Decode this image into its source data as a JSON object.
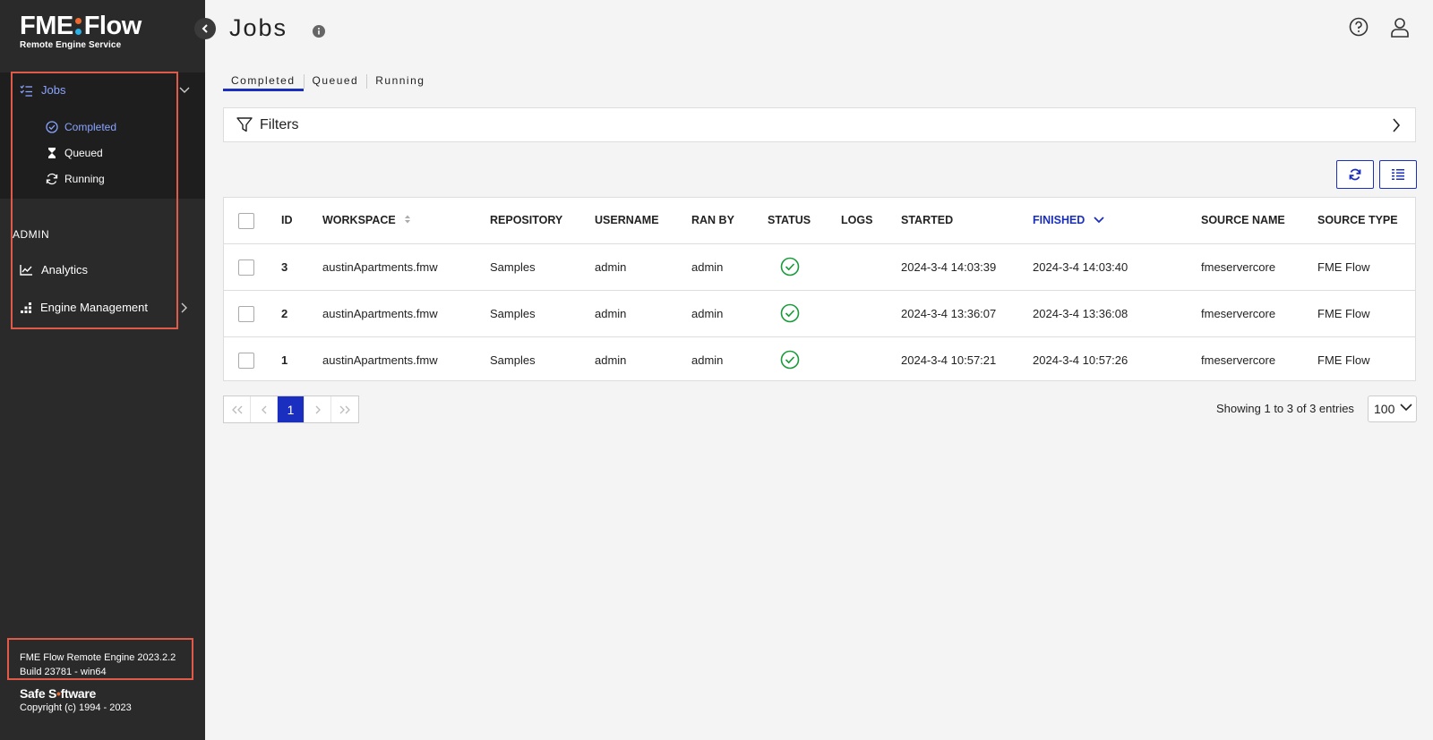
{
  "app": {
    "logo_main_left": "FME",
    "logo_main_right": "Flow",
    "logo_sub": "Remote Engine Service",
    "accent": "#1a2fbf",
    "sidebar_bg": "#2a2a2a",
    "highlight": "#e05a4a"
  },
  "sidebar": {
    "jobs_label": "Jobs",
    "sub_items": [
      {
        "label": "Completed",
        "icon": "check-circle-icon",
        "active": true
      },
      {
        "label": "Queued",
        "icon": "hourglass-icon"
      },
      {
        "label": "Running",
        "icon": "sync-icon"
      }
    ],
    "admin_label": "ADMIN",
    "analytics_label": "Analytics",
    "engine_label": "Engine Management",
    "version_line1": "FME Flow Remote Engine 2023.2.2",
    "version_line2": "Build 23781 - win64",
    "safe_logo_left": "Safe S",
    "safe_logo_right": "ftware",
    "copyright": "Copyright (c) 1994 - 2023"
  },
  "header": {
    "title": "Jobs",
    "help_icon": "help-icon",
    "user_icon": "user-icon"
  },
  "tabs": [
    {
      "label": "Completed",
      "active": true
    },
    {
      "label": "Queued"
    },
    {
      "label": "Running"
    }
  ],
  "filters": {
    "label": "Filters"
  },
  "table": {
    "columns": [
      "ID",
      "WORKSPACE",
      "REPOSITORY",
      "USERNAME",
      "RAN BY",
      "STATUS",
      "LOGS",
      "STARTED",
      "FINISHED",
      "SOURCE NAME",
      "SOURCE TYPE"
    ],
    "rows": [
      {
        "id": "3",
        "workspace": "austinApartments.fmw",
        "repository": "Samples",
        "username": "admin",
        "ran_by": "admin",
        "status": "success",
        "started": "2024-3-4 14:03:39",
        "finished": "2024-3-4 14:03:40",
        "source_name": "fmeservercore",
        "source_type": "FME Flow"
      },
      {
        "id": "2",
        "workspace": "austinApartments.fmw",
        "repository": "Samples",
        "username": "admin",
        "ran_by": "admin",
        "status": "success",
        "started": "2024-3-4 13:36:07",
        "finished": "2024-3-4 13:36:08",
        "source_name": "fmeservercore",
        "source_type": "FME Flow"
      },
      {
        "id": "1",
        "workspace": "austinApartments.fmw",
        "repository": "Samples",
        "username": "admin",
        "ran_by": "admin",
        "status": "success",
        "started": "2024-3-4 10:57:21",
        "finished": "2024-3-4 10:57:26",
        "source_name": "fmeservercore",
        "source_type": "FME Flow"
      }
    ]
  },
  "pagination": {
    "current_page": "1",
    "showing": "Showing 1 to 3 of 3 entries",
    "page_size": "100"
  }
}
